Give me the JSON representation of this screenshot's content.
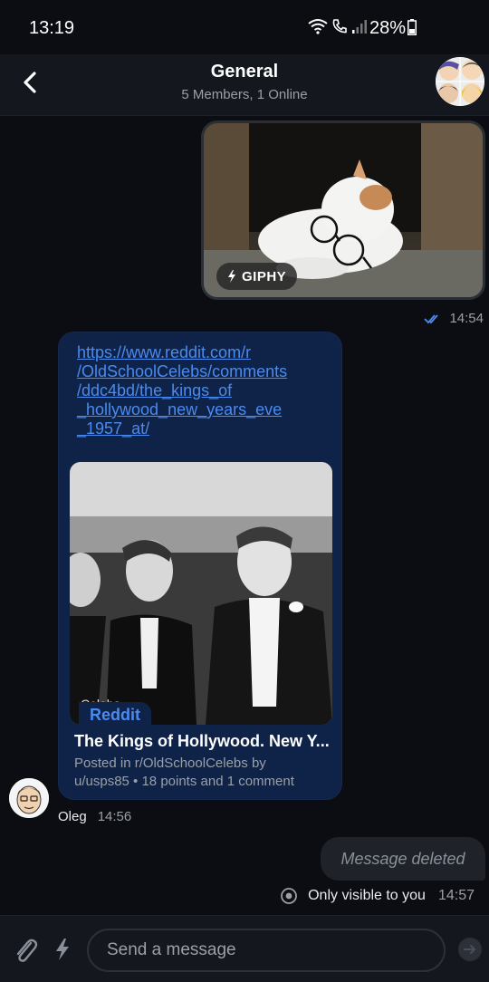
{
  "status_bar": {
    "time": "13:19",
    "battery": "28%",
    "icons": [
      "wifi-icon",
      "call-icon",
      "signal-icon",
      "battery-icon"
    ]
  },
  "header": {
    "title": "General",
    "subtitle": "5 Members, 1 Online",
    "back_icon": "chevron-left-icon"
  },
  "messages": {
    "giphy": {
      "badge": "GIPHY",
      "time": "14:54",
      "read_icon": "double-check-icon"
    },
    "link": {
      "url": "https://www.reddit.com/r/OldSchoolCelebs/comments/ddc4bd/the_kings_of_hollywood_new_years_eve_1957_at/",
      "url_display": "https://www.reddit.com/r\n/OldSchoolCelebs/comments\n/ddc4bd/the_kings_of\n_hollywood_new_years_eve\n_1957_at/",
      "source": "Reddit",
      "title": "The Kings of Hollywood. New Y...",
      "description": "Posted in r/OldSchoolCelebs by u/usps85 • 18 points and 1 comment",
      "author": "Oleg",
      "time": "14:56"
    },
    "deleted": {
      "text": "Message deleted",
      "visibility": "Only visible to you",
      "time": "14:57",
      "visibility_icon": "eye-icon"
    }
  },
  "composer": {
    "placeholder": "Send a message",
    "attach_icon": "paperclip-icon",
    "commands_icon": "lightning-icon",
    "send_icon": "send-arrow-icon"
  },
  "colors": {
    "background": "#0b0d12",
    "header": "#14171d",
    "link_bubble": "#0f2247",
    "accent": "#4a8bf0"
  }
}
